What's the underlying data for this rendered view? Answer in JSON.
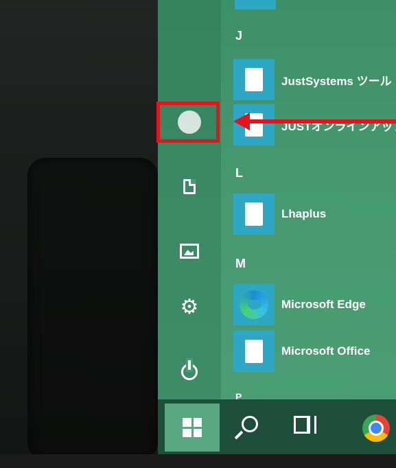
{
  "start_menu": {
    "sections": [
      {
        "letter": "J",
        "apps": [
          {
            "label": "JustSystems ツール",
            "icon": "tile-doc-icon"
          },
          {
            "label": "JUSTオンラインアップ",
            "icon": "tile-doc-icon"
          }
        ]
      },
      {
        "letter": "L",
        "apps": [
          {
            "label": "Lhaplus",
            "icon": "tile-doc-icon"
          }
        ]
      },
      {
        "letter": "M",
        "apps": [
          {
            "label": "Microsoft Edge",
            "icon": "edge-icon"
          },
          {
            "label": "Microsoft Office",
            "icon": "tile-doc-icon"
          }
        ]
      }
    ],
    "next_letter": "P",
    "rail": [
      {
        "name": "account",
        "icon": "user-circle-icon"
      },
      {
        "name": "documents",
        "icon": "document-icon"
      },
      {
        "name": "pictures",
        "icon": "picture-icon"
      },
      {
        "name": "settings",
        "icon": "gear-icon"
      },
      {
        "name": "power",
        "icon": "power-icon"
      }
    ]
  },
  "taskbar": {
    "items": [
      "start-icon",
      "search-icon",
      "task-view-icon",
      "chrome-icon"
    ]
  },
  "annotation": {
    "color": "#e8131a",
    "target": "account"
  },
  "colors": {
    "menu_bg": "#46996f",
    "tile": "#2ea7c4",
    "taskbar": "#1d4e3a",
    "start_active": "#5aa882"
  }
}
